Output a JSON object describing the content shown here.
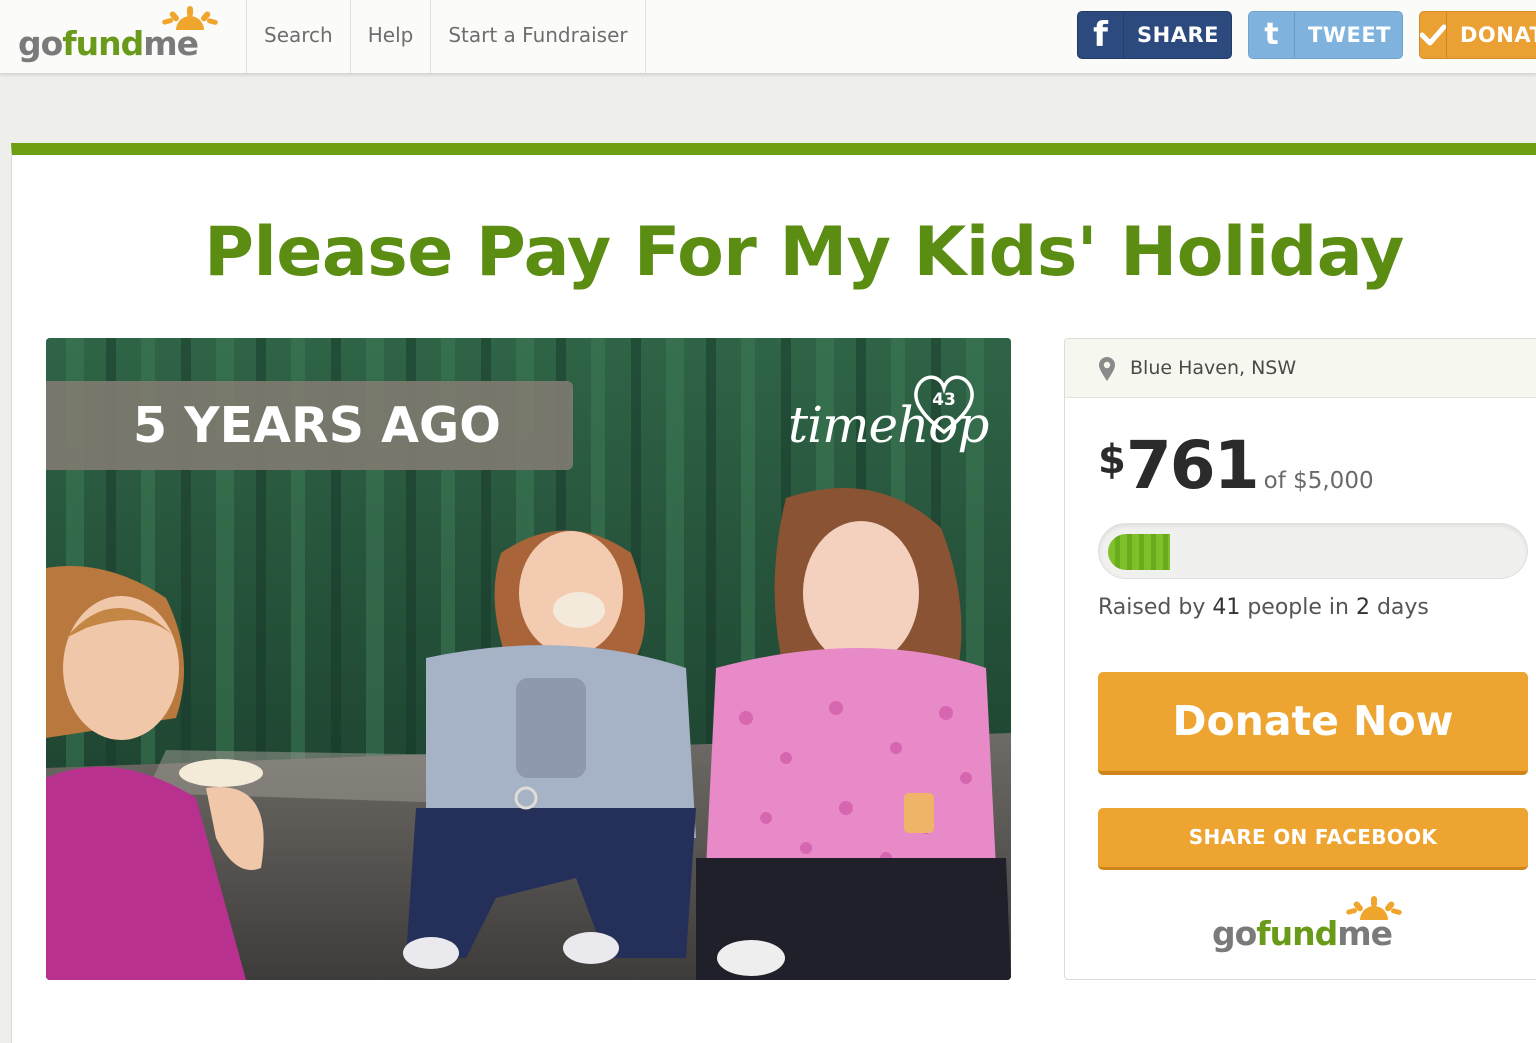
{
  "header": {
    "logo": {
      "go": "go",
      "fund": "fund",
      "me": "me"
    },
    "nav": [
      "Search",
      "Help",
      "Start a Fundraiser"
    ],
    "buttons": {
      "facebook_icon": "f",
      "share": "SHARE",
      "twitter_icon": "t",
      "tweet": "TWEET",
      "donate_icon": "checkmark-icon",
      "donate": "DONATE"
    }
  },
  "campaign": {
    "title": "Please Pay For My Kids' Holiday",
    "photo": {
      "badge": "5 YEARS AGO",
      "watermark": "timehop",
      "heart_count": "43"
    },
    "location": "Blue Haven, NSW",
    "currency": "$",
    "raised_amount": "761",
    "goal_text": "of $5,000",
    "progress_fraction": 0.1522,
    "raised_by": {
      "prefix": "Raised by",
      "people": "41",
      "middle": "people in",
      "days": "2",
      "suffix": "days"
    },
    "donate_label": "Donate Now",
    "share_label": "SHARE ON FACEBOOK"
  },
  "colors": {
    "brand_green": "#5a8d12",
    "accent_orange": "#eea431",
    "facebook_blue": "#2c4a7e",
    "twitter_blue": "#7fb3de"
  }
}
